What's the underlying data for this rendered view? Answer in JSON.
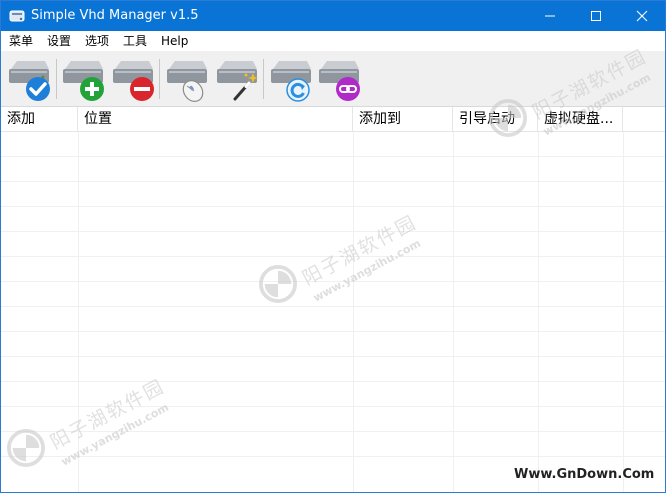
{
  "window": {
    "title": "Simple Vhd Manager v1.5",
    "accent": "#0a74d6"
  },
  "menu": {
    "items": [
      {
        "id": "menu",
        "label": "菜单"
      },
      {
        "id": "settings",
        "label": "设置"
      },
      {
        "id": "options",
        "label": "选项"
      },
      {
        "id": "tools",
        "label": "工具"
      },
      {
        "id": "help",
        "label": "Help"
      }
    ]
  },
  "toolbar": {
    "buttons": [
      {
        "id": "check",
        "icon": "drive-check-icon",
        "badge_color": "#1e7fd8"
      },
      {
        "id": "add",
        "icon": "drive-add-icon",
        "badge_color": "#22a33a"
      },
      {
        "id": "remove",
        "icon": "drive-remove-icon",
        "badge_color": "#d9262c"
      },
      {
        "id": "mount",
        "icon": "drive-mouse-icon",
        "badge_color": "#a0a0a0"
      },
      {
        "id": "wizard",
        "icon": "drive-wand-icon",
        "badge_color": "#f0c020"
      },
      {
        "id": "refresh",
        "icon": "drive-refresh-icon",
        "badge_color": "#2a8fe0"
      },
      {
        "id": "link",
        "icon": "drive-link-icon",
        "badge_color": "#b02ac8"
      }
    ]
  },
  "list": {
    "columns": [
      {
        "id": "add",
        "label": "添加"
      },
      {
        "id": "location",
        "label": "位置"
      },
      {
        "id": "added_to",
        "label": "添加到"
      },
      {
        "id": "boot",
        "label": "引导启动"
      },
      {
        "id": "vdisk",
        "label": "虚拟硬盘..."
      }
    ],
    "rows": []
  },
  "watermark": {
    "text": "阳子湖软件园",
    "url": "www.yangzihu.com"
  },
  "site_mark": "Www.GnDown.Com"
}
